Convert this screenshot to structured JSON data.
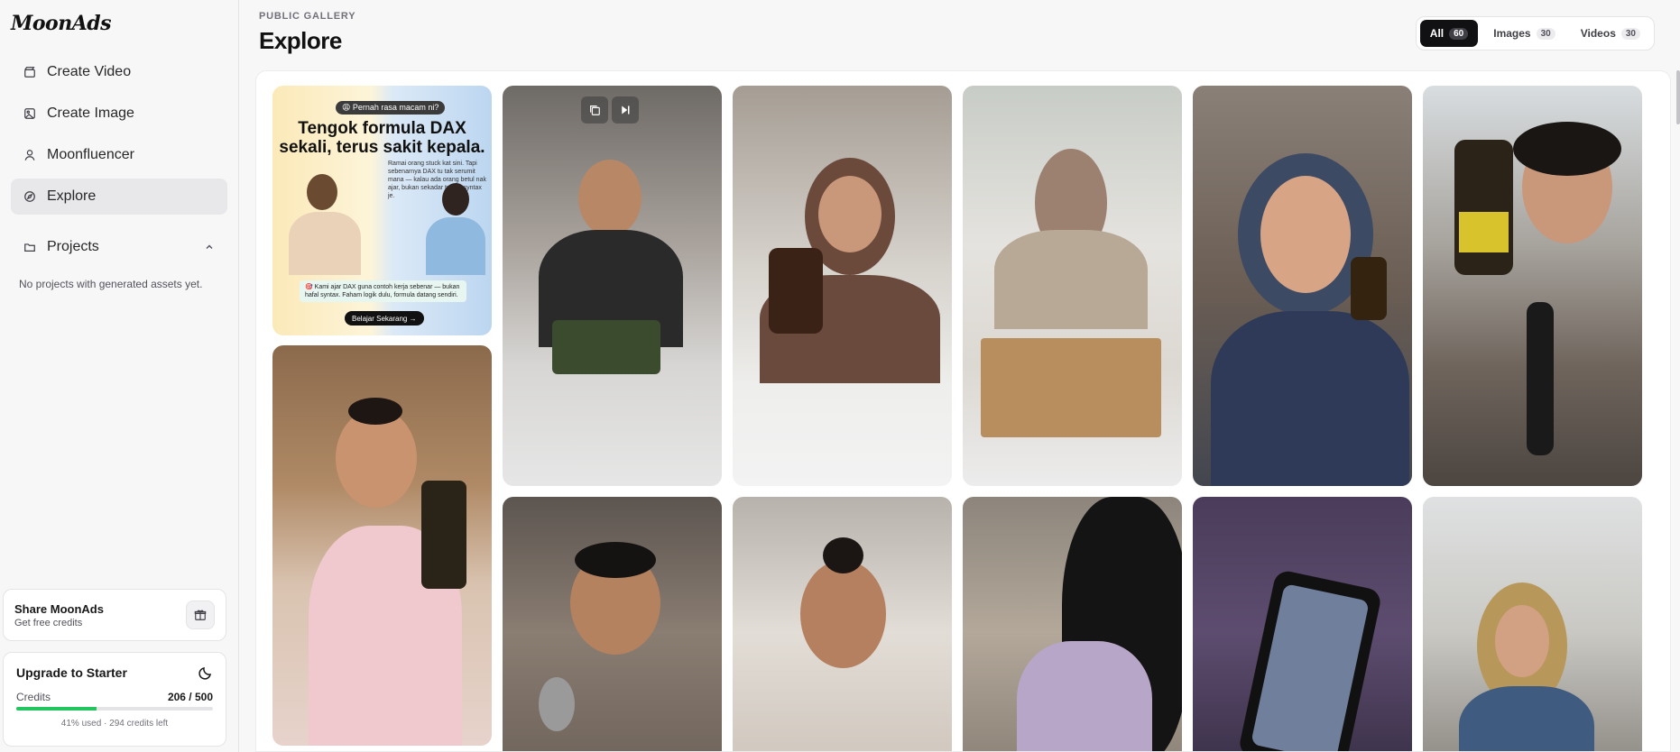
{
  "brand": {
    "logo_text": "MoonAds"
  },
  "sidebar": {
    "nav": [
      {
        "label": "Create Video",
        "icon": "clapperboard-icon"
      },
      {
        "label": "Create Image",
        "icon": "image-icon"
      },
      {
        "label": "Moonfluencer",
        "icon": "user-icon"
      },
      {
        "label": "Explore",
        "icon": "compass-icon",
        "active": true
      }
    ],
    "projects_label": "Projects",
    "projects_empty": "No projects with generated assets yet.",
    "share": {
      "title": "Share MoonAds",
      "subtitle": "Get free credits"
    },
    "upgrade": {
      "title": "Upgrade to Starter",
      "credits_label": "Credits",
      "credits_value": "206 / 500",
      "used_fraction": 0.41,
      "note": "41% used · 294 credits left"
    }
  },
  "header": {
    "eyebrow": "PUBLIC GALLERY",
    "title": "Explore",
    "filters": [
      {
        "label": "All",
        "count": "60",
        "active": true
      },
      {
        "label": "Images",
        "count": "30"
      },
      {
        "label": "Videos",
        "count": "30"
      }
    ]
  },
  "ad_tile": {
    "badge": "😩 Pernah rasa macam ni?",
    "title": "Tengok formula DAX sekali, terus sakit kepala.",
    "body": "Ramai orang stuck kat sini. Tapi sebenarnya DAX tu tak serumit mana — kalau ada orang betul nak ajar, bukan sekadar tunjuk syntax je.",
    "strip": "🎯 Kami ajar DAX guna contoh kerja sebenar — bukan hafal syntax. Faham logik dulu, formula datang sendiri.",
    "cta": "Belajar Sekarang →"
  },
  "colors": {
    "accent": "#22c55e",
    "active_filter": "#111114"
  }
}
